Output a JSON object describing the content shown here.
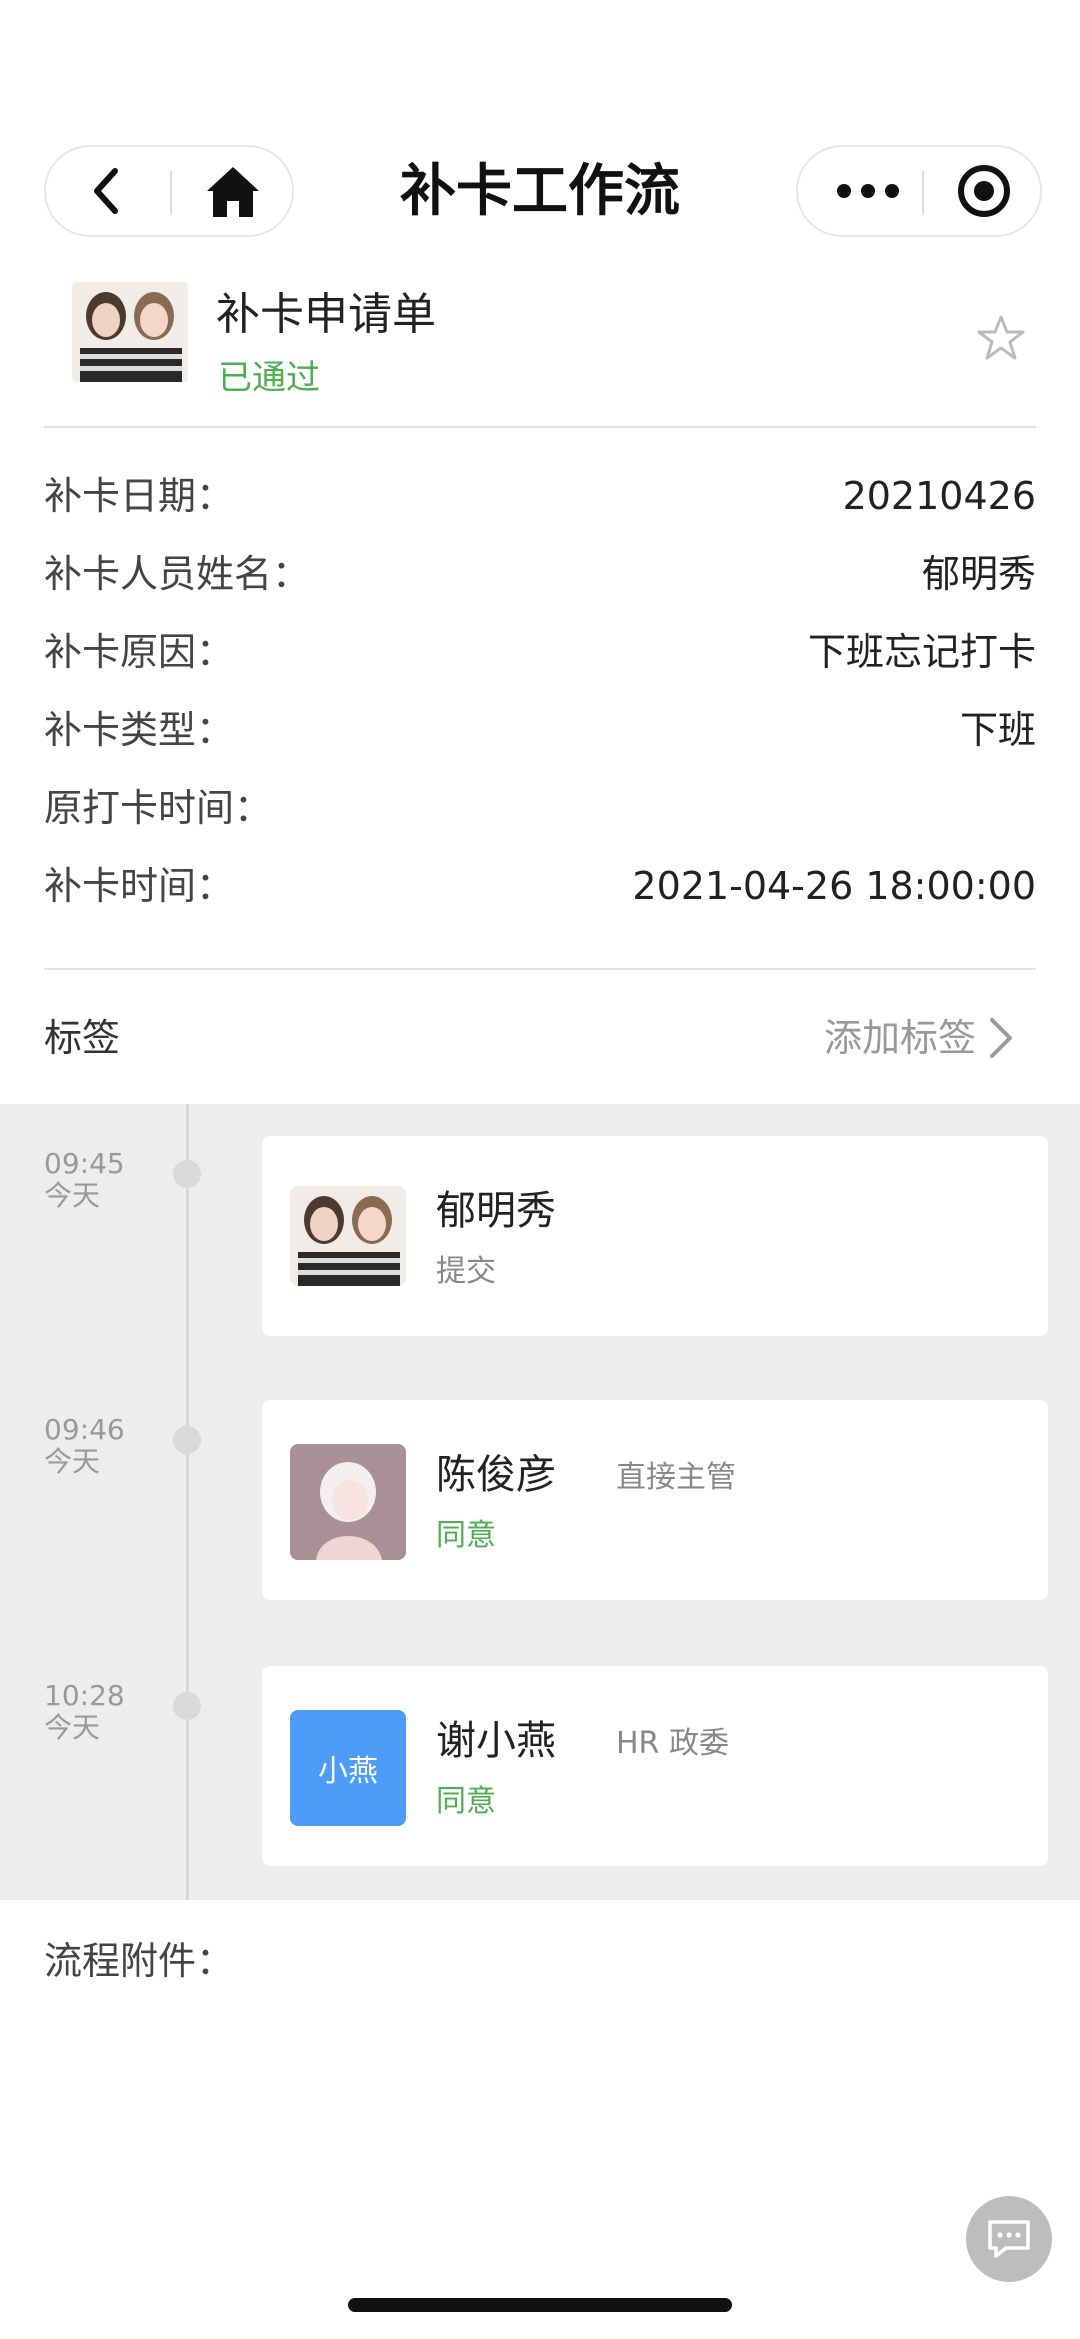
{
  "nav": {
    "title": "补卡工作流",
    "icons": [
      "back-icon",
      "home-icon",
      "more-icon",
      "close-target-icon"
    ]
  },
  "header": {
    "title": "补卡申请单",
    "status": "已通过",
    "status_color": "#4caf50"
  },
  "details": [
    {
      "label": "补卡日期：",
      "value": "20210426"
    },
    {
      "label": "补卡人员姓名：",
      "value": "郁明秀"
    },
    {
      "label": "补卡原因：",
      "value": "下班忘记打卡"
    },
    {
      "label": "补卡类型：",
      "value": "下班"
    },
    {
      "label": "原打卡时间：",
      "value": ""
    },
    {
      "label": "补卡时间：",
      "value": "2021-04-26 18:00:00"
    }
  ],
  "tags": {
    "label": "标签",
    "add_label": "添加标签"
  },
  "timeline": [
    {
      "time": "09:45",
      "day": "今天",
      "name": "郁明秀",
      "role": "",
      "action": "提交",
      "action_color": "#888888"
    },
    {
      "time": "09:46",
      "day": "今天",
      "name": "陈俊彦",
      "role": "直接主管",
      "action": "同意",
      "action_color": "#4caf50"
    },
    {
      "time": "10:28",
      "day": "今天",
      "name": "谢小燕",
      "role": "HR 政委",
      "action": "同意",
      "action_color": "#4caf50",
      "avatar_text": "小燕"
    }
  ],
  "attachments": {
    "label": "流程附件："
  }
}
